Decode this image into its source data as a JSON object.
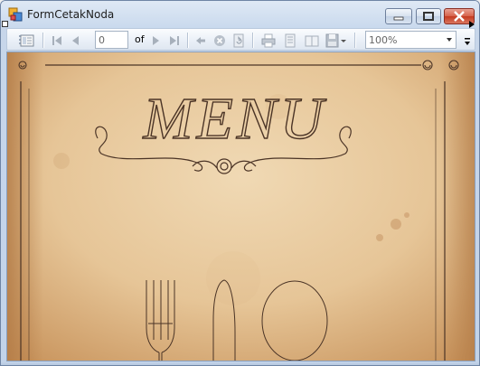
{
  "window": {
    "title": "FormCetakNoda"
  },
  "toolbar": {
    "page_value": "0",
    "of_label": "of",
    "zoom_value": "100%",
    "icons": [
      "document-map-icon",
      "first-page-icon",
      "previous-page-icon",
      "next-page-icon",
      "last-page-icon",
      "back-icon",
      "stop-icon",
      "refresh-icon",
      "print-icon",
      "print-layout-icon",
      "page-setup-icon",
      "export-icon",
      "zoom-dropdown-icon"
    ]
  },
  "report": {
    "heading": "MENU"
  },
  "colors": {
    "paper": "#e8c9a0",
    "ink": "#5a4030",
    "titlebar": "#c9d9ed",
    "close": "#c4391f"
  }
}
